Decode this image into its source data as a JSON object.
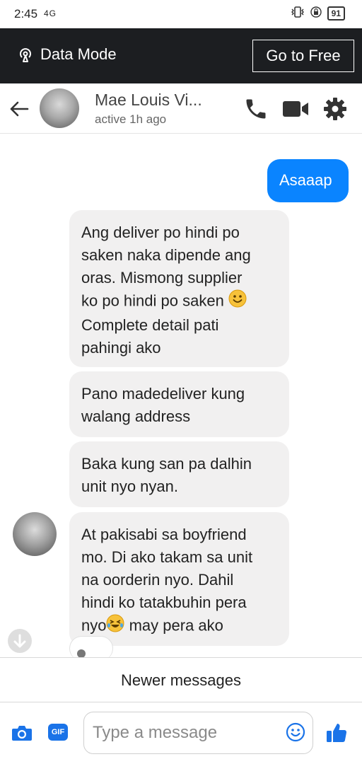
{
  "status_bar": {
    "time": "2:45",
    "signal": "4G",
    "battery": "91"
  },
  "data_mode": {
    "label": "Data Mode",
    "button": "Go to Free"
  },
  "header": {
    "contact_name": "Mae Louis Vi...",
    "status": "active 1h ago"
  },
  "messages": [
    {
      "direction": "outgoing",
      "text": "Asaaap"
    },
    {
      "direction": "incoming",
      "lines": [
        "Ang deliver po hindi po",
        "saken naka dipende ang",
        "oras. Mismong supplier",
        "ko po hindi po saken",
        "Complete detail pati",
        "pahingi ako"
      ]
    },
    {
      "direction": "incoming",
      "lines": [
        "Pano madedeliver kung",
        "walang address"
      ]
    },
    {
      "direction": "incoming",
      "lines": [
        "Baka kung san pa dalhin",
        "unit nyo nyan."
      ]
    },
    {
      "direction": "incoming",
      "lines": [
        "At pakisabi sa boyfriend",
        "mo. Di ako takam sa unit",
        "na oorderin nyo. Dahil",
        "hindi ko tatakbuhin pera",
        "nyo",
        "may pera ako"
      ]
    }
  ],
  "newer_messages": "Newer messages",
  "composer": {
    "placeholder": "Type a message",
    "gif_label": "GIF"
  },
  "colors": {
    "accent": "#0a84ff",
    "data_bar": "#1c1e21",
    "incoming_bubble": "#f1f0f0"
  }
}
